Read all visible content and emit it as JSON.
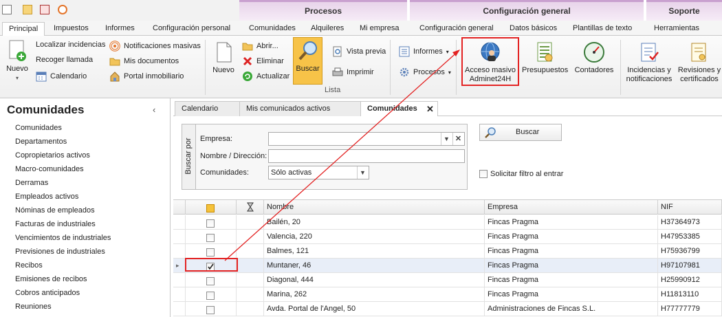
{
  "ribbon_context": {
    "procesos": "Procesos",
    "configuracion": "Configuración general",
    "soporte": "Soporte"
  },
  "tabs": {
    "principal": "Principal",
    "impuestos": "Impuestos",
    "informes": "Informes",
    "config_personal": "Configuración personal",
    "comunidades": "Comunidades",
    "alquileres": "Alquileres",
    "mi_empresa": "Mi empresa",
    "config_general": "Configuración general",
    "datos_basicos": "Datos básicos",
    "plantillas": "Plantillas de texto",
    "herramientas": "Herramientas"
  },
  "ribbon": {
    "nuevo_dropdown": "Nuevo",
    "localizar": "Localizar incidencias",
    "recoger": "Recoger llamada",
    "calendario": "Calendario",
    "notificaciones": "Notificaciones masivas",
    "mis_documentos": "Mis documentos",
    "portal": "Portal inmobiliario",
    "nuevo": "Nuevo",
    "abrir": "Abrir...",
    "eliminar": "Eliminar",
    "actualizar": "Actualizar",
    "buscar": "Buscar",
    "vista_previa": "Vista previa",
    "imprimir": "Imprimir",
    "lista_group": "Lista",
    "informes_dd": "Informes",
    "procesos_dd": "Procesos",
    "acceso_masivo_1": "Acceso masivo",
    "acceso_masivo_2": "Adminet24H",
    "presupuestos": "Presupuestos",
    "contadores": "Contadores",
    "incidencias_1": "Incidencias y",
    "incidencias_2": "notificaciones",
    "revisiones_1": "Revisiones y",
    "revisiones_2": "certificados"
  },
  "sidebar": {
    "title": "Comunidades",
    "items": [
      "Comunidades",
      "Departamentos",
      "Copropietarios activos",
      "Macro-comunidades",
      "Derramas",
      "Empleados activos",
      "Nóminas de empleados",
      "Facturas de industriales",
      "Vencimientos de industriales",
      "Previsiones de industriales",
      "Recibos",
      "Emisiones de recibos",
      "Cobros anticipados",
      "Reuniones"
    ]
  },
  "doc_tabs": {
    "calendario": "Calendario",
    "comunicados": "Mis comunicados activos",
    "comunidades": "Comunidades"
  },
  "filter": {
    "group_label": "Buscar por",
    "empresa_label": "Empresa:",
    "empresa_value": "",
    "nombre_label": "Nombre / Dirección:",
    "nombre_value": "",
    "comunidades_label": "Comunidades:",
    "comunidades_value": "Sólo activas",
    "buscar_button": "Buscar",
    "solicitar": "Solicitar filtro al entrar"
  },
  "grid": {
    "columns": {
      "nombre": "Nombre",
      "empresa": "Empresa",
      "nif": "NIF"
    },
    "rows": [
      {
        "nombre": "Bailén, 20",
        "empresa": "Fincas Pragma",
        "nif": "H37364973",
        "checked": false
      },
      {
        "nombre": "Valencia, 220",
        "empresa": "Fincas Pragma",
        "nif": "H47953385",
        "checked": false
      },
      {
        "nombre": "Balmes, 121",
        "empresa": "Fincas Pragma",
        "nif": "H75936799",
        "checked": false
      },
      {
        "nombre": "Muntaner, 46",
        "empresa": "Fincas Pragma",
        "nif": "H97107981",
        "checked": true
      },
      {
        "nombre": "Diagonal, 444",
        "empresa": "Fincas Pragma",
        "nif": "H25990912",
        "checked": false
      },
      {
        "nombre": "Marina, 262",
        "empresa": "Fincas Pragma",
        "nif": "H11813110",
        "checked": false
      },
      {
        "nombre": "Avda. Portal de l'Angel, 50",
        "empresa": "Administraciones de Fincas S.L.",
        "nif": "H77777779",
        "checked": false
      }
    ]
  },
  "colors": {
    "highlight_red": "#e32222",
    "context_purple": "#e8d4ea",
    "buscar_orange": "#f7c348"
  }
}
